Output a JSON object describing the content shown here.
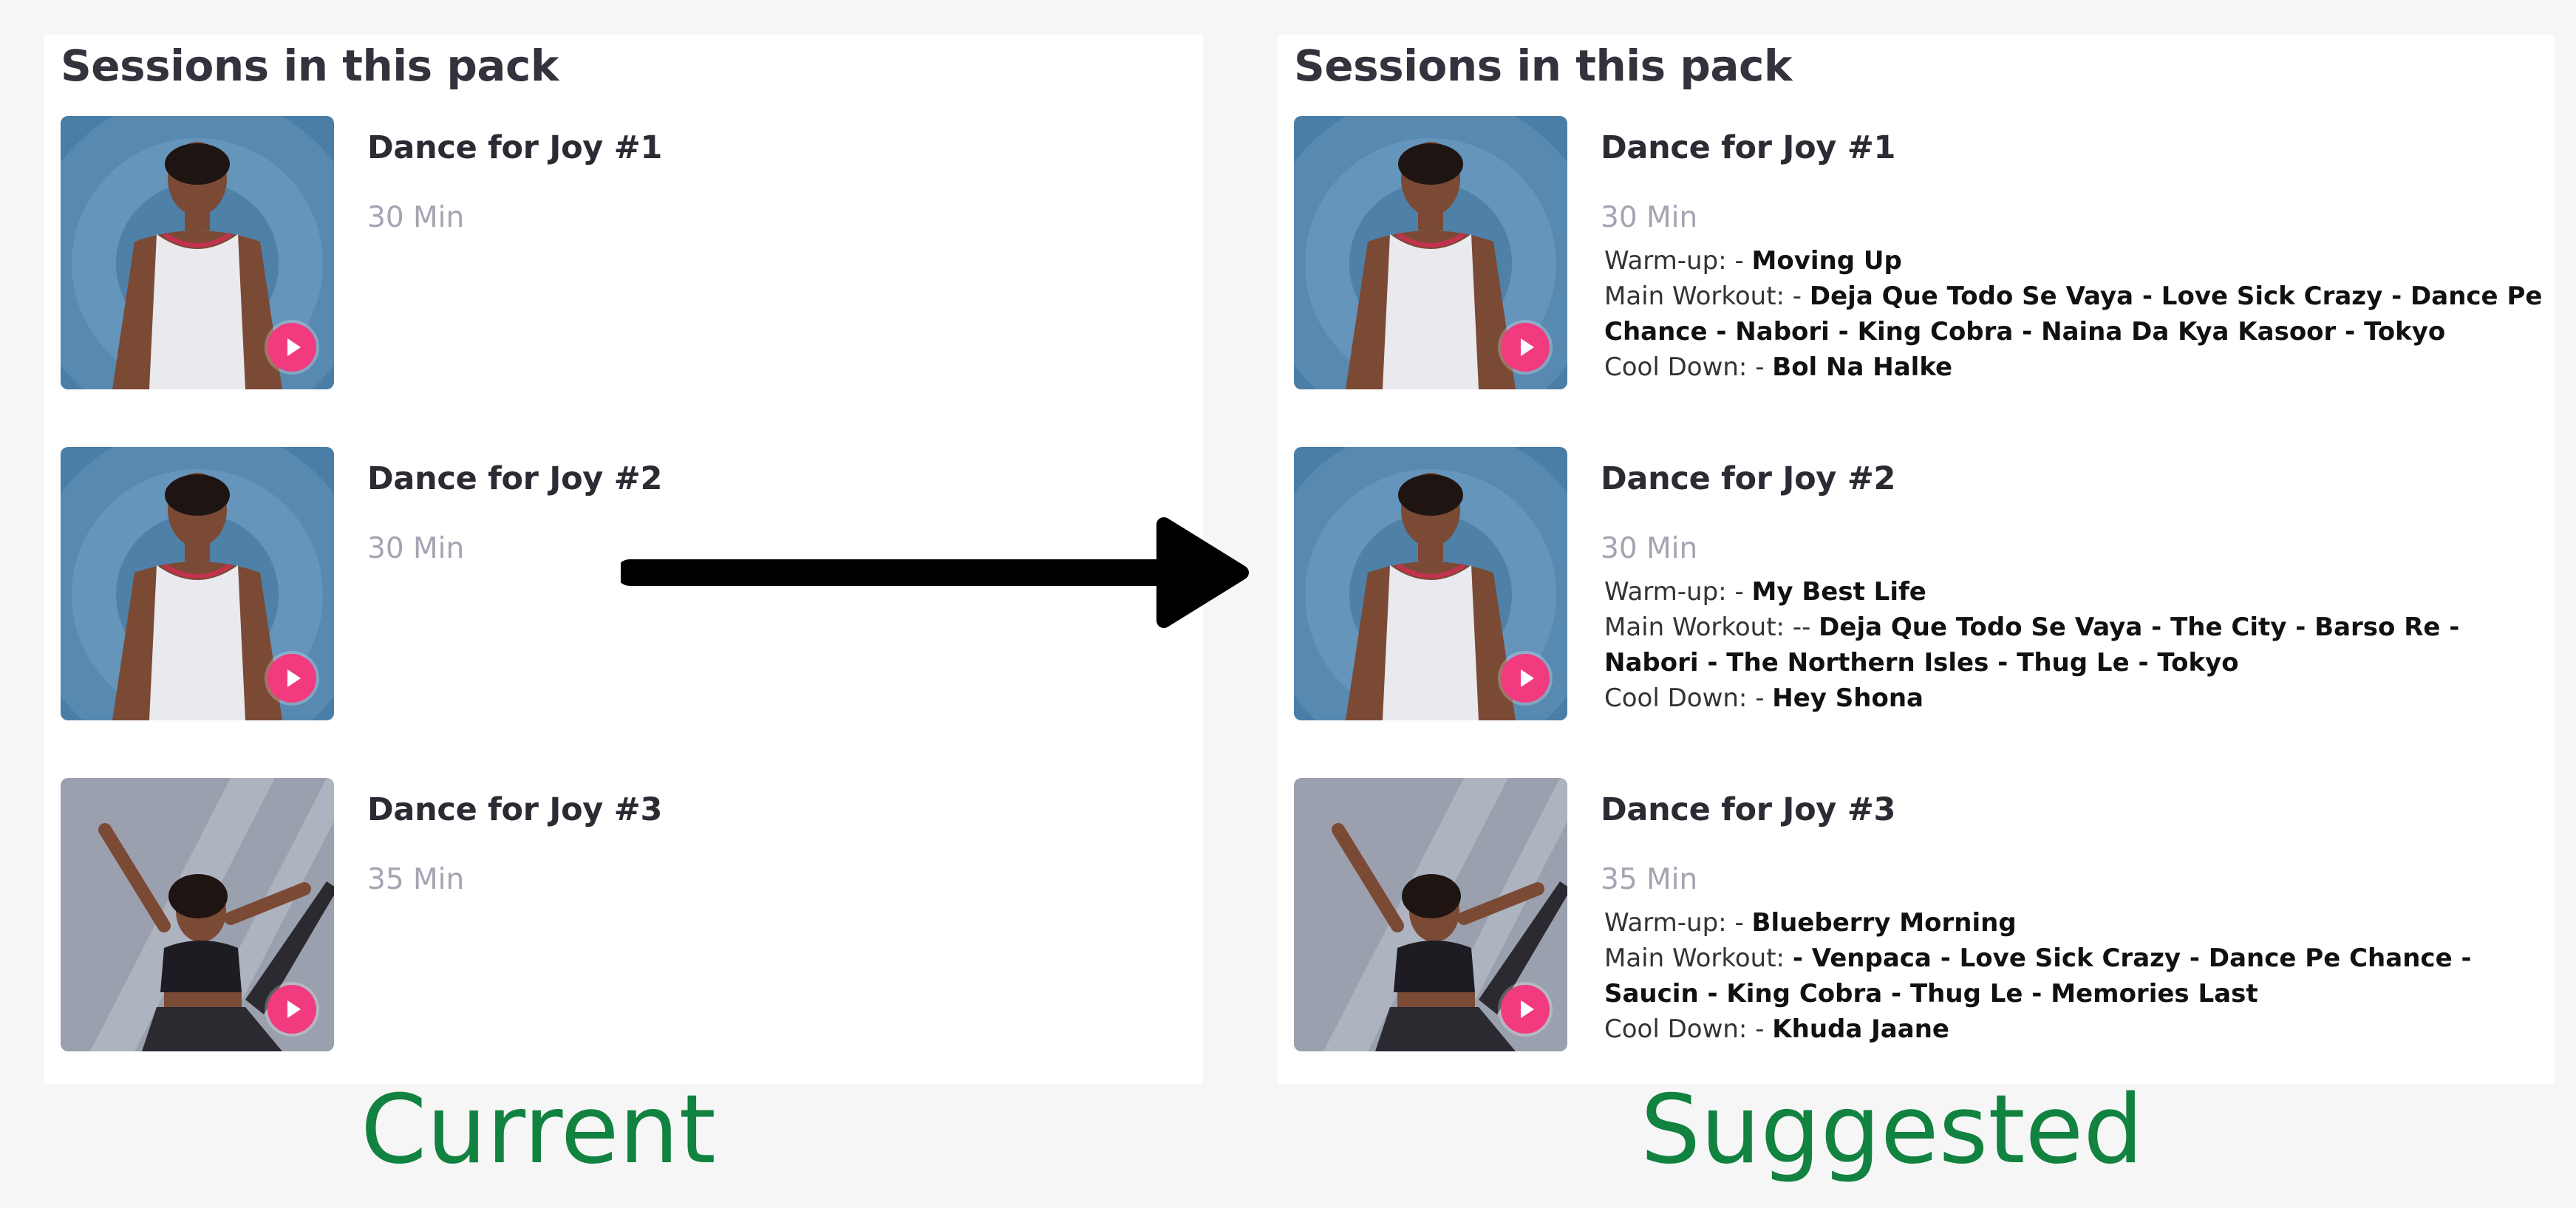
{
  "current": {
    "title": "Sessions in this pack",
    "caption": "Current",
    "sessions": [
      {
        "title": "Dance for Joy #1",
        "duration": "30 Min",
        "image": "woman-standing-photo"
      },
      {
        "title": "Dance for Joy #2",
        "duration": "30 Min",
        "image": "woman-standing-photo"
      },
      {
        "title": "Dance for Joy #3",
        "duration": "35 Min",
        "image": "woman-dancing-photo"
      }
    ]
  },
  "suggested": {
    "title": "Sessions in this pack",
    "caption": "Suggested",
    "sessions": [
      {
        "title": "Dance for Joy #1",
        "duration": "30 Min",
        "image": "woman-standing-photo",
        "warmup_label": "Warm-up: - ",
        "warmup": "Moving Up",
        "main_label": "Main Workout: - ",
        "main": "Deja Que Todo Se Vaya - Love Sick Crazy - Dance Pe Chance - Nabori - King Cobra - Naina Da Kya Kasoor - Tokyo",
        "cooldown_label": "Cool Down: - ",
        "cooldown": "Bol Na Halke"
      },
      {
        "title": "Dance for Joy #2",
        "duration": "30 Min",
        "image": "woman-standing-photo",
        "warmup_label": "Warm-up: - ",
        "warmup": "My Best Life",
        "main_label": "Main Workout: -- ",
        "main": "Deja Que Todo Se Vaya - The City - Barso Re - Nabori - The Northern Isles - Thug Le - Tokyo",
        "cooldown_label": "Cool Down: - ",
        "cooldown": "Hey Shona"
      },
      {
        "title": "Dance for Joy #3",
        "duration": "35 Min",
        "image": "woman-dancing-photo",
        "warmup_label": "Warm-up: - ",
        "warmup": "Blueberry Morning",
        "main_label": "Main Workout: ",
        "main": "- Venpaca - Love Sick Crazy - Dance Pe Chance - Saucin - King Cobra - Thug Le - Memories Last",
        "cooldown_label": "Cool Down: - ",
        "cooldown": "Khuda Jaane"
      }
    ]
  },
  "colors": {
    "caption": "#118240",
    "play_button": "#f23a7f",
    "thumb_blue": "#4a7ea6",
    "thumb_grey": "#9aa0ad"
  },
  "icons": [
    "play-icon",
    "right-arrow-icon"
  ]
}
